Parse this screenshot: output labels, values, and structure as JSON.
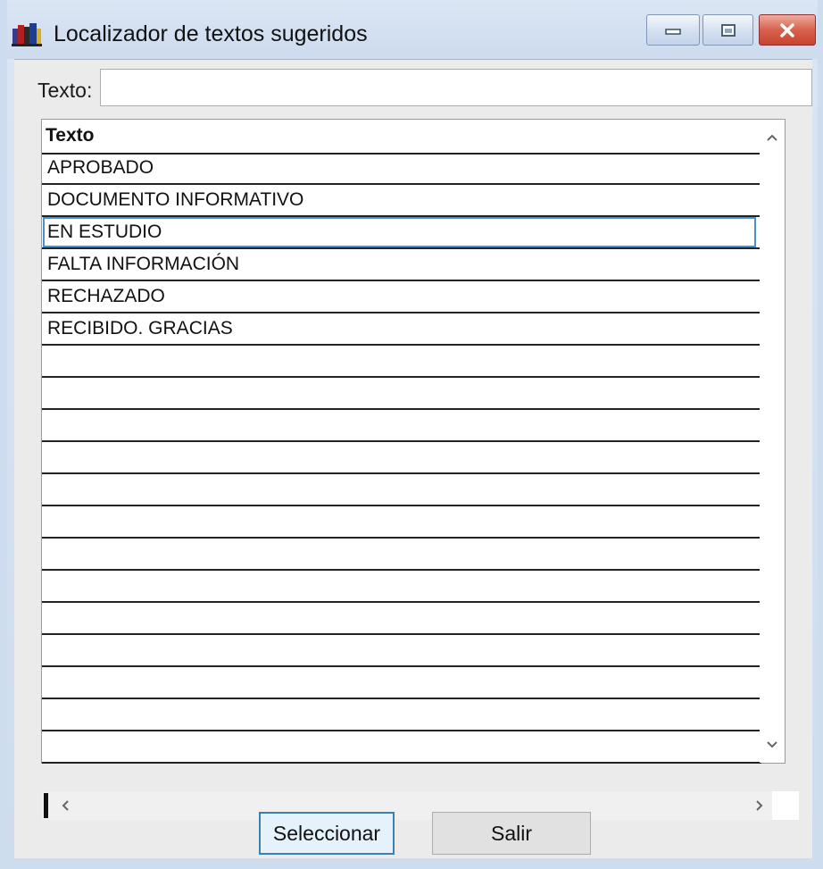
{
  "window": {
    "title": "Localizador de textos sugeridos",
    "icon": "app-books-icon",
    "controls": [
      "minimize-icon",
      "maximize-icon",
      "close-icon"
    ]
  },
  "search": {
    "label": "Texto:",
    "value": ""
  },
  "grid": {
    "column_header": "Texto",
    "rows": [
      "APROBADO",
      "DOCUMENTO INFORMATIVO",
      "EN ESTUDIO",
      "FALTA INFORMACIÓN",
      "RECHAZADO",
      "RECIBIDO. GRACIAS"
    ],
    "selected_row": "EN ESTUDIO",
    "empty_rows": 13
  },
  "buttons": {
    "select_label": "Seleccionar",
    "exit_label": "Salir"
  },
  "colors": {
    "title_bar": "#d3e0f0",
    "close_button": "#d4543d",
    "selection": "#4b8fd3",
    "client_bg": "#ebebeb"
  }
}
